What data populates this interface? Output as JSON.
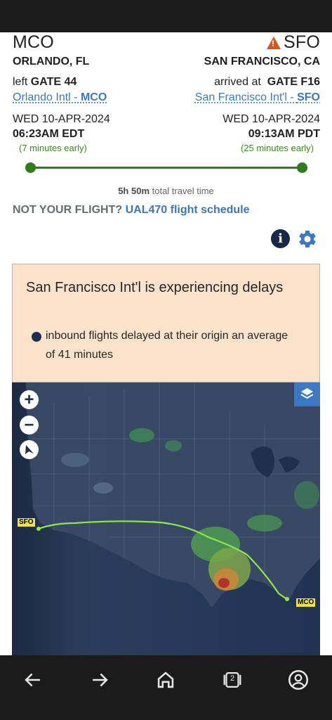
{
  "origin": {
    "code": "MCO",
    "city": "ORLANDO, FL",
    "gate_prefix": "left",
    "gate": "GATE 44",
    "airport_name": "Orlando Intl - ",
    "airport_code": "MCO",
    "date": "WED 10-APR-2024",
    "time": "06:23AM EDT",
    "early_note": "(7 minutes early)"
  },
  "destination": {
    "code": "SFO",
    "city": "SAN FRANCISCO, CA",
    "gate_prefix": "arrived at",
    "gate": "GATE F16",
    "airport_name": "San Francisco Int'l - ",
    "airport_code": "SFO",
    "date": "WED 10-APR-2024",
    "time": "09:13AM PDT",
    "early_note": "(25 minutes early)",
    "warning_icon": "warning-icon"
  },
  "progress": {
    "fraction_complete": 1.0
  },
  "travel_time": {
    "value": "5h 50m",
    "suffix": " total travel time"
  },
  "not_your_flight": {
    "prompt": "NOT YOUR FLIGHT? ",
    "link": "UAL470 flight schedule"
  },
  "toolbar": {
    "info_icon": "info-icon",
    "settings_icon": "gear-icon"
  },
  "delay_alert": {
    "title": "San Francisco Int'l is experiencing delays",
    "bullet": "inbound flights delayed at their origin an average of 41 minutes"
  },
  "map": {
    "zoom_in": "+",
    "zoom_out": "−",
    "compass_icon": "compass-icon",
    "layers_icon": "layers-icon",
    "origin_label": "MCO",
    "destination_label": "SFO",
    "route_color": "#8ee84a"
  },
  "nav": [
    "back-icon",
    "forward-icon",
    "home-icon",
    "tabs-icon",
    "account-icon"
  ],
  "nav_tab_count": "2",
  "colors": {
    "accent": "#3b78c4",
    "success": "#2f7d1b",
    "alert_bg": "#fbe3cb",
    "warning": "#d6561d"
  }
}
